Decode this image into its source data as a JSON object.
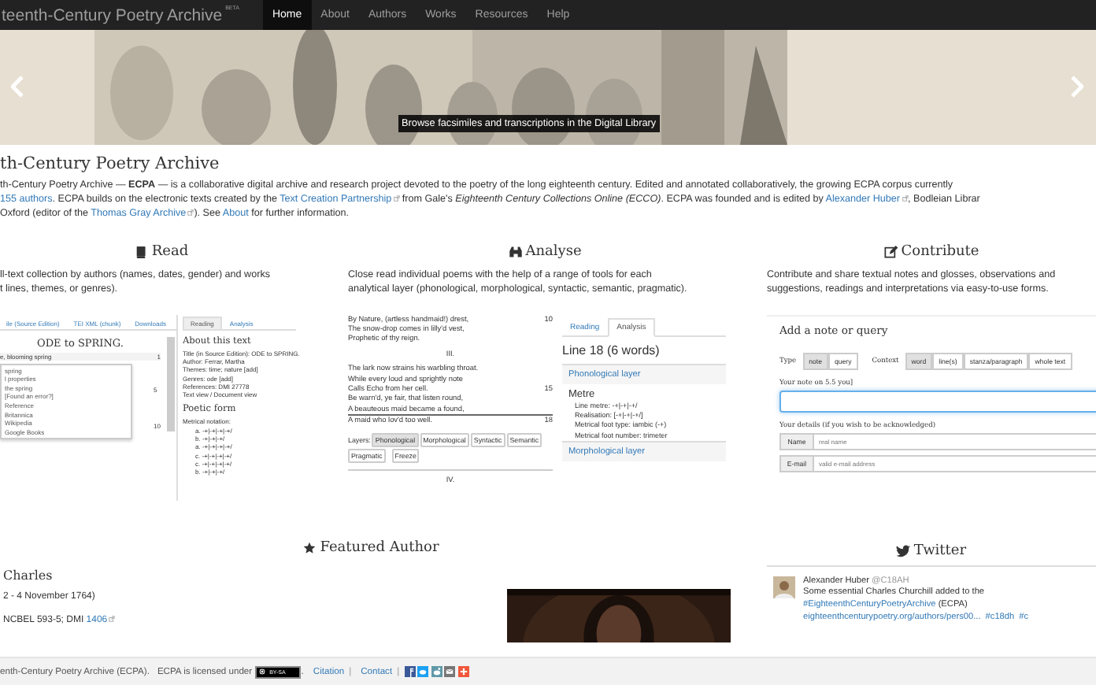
{
  "navbar": {
    "brand": "teenth-Century Poetry Archive",
    "badge": "BETA",
    "items": [
      {
        "label": "Home",
        "selected": true
      },
      {
        "label": "About",
        "selected": false
      },
      {
        "label": "Authors",
        "selected": false
      },
      {
        "label": "Works",
        "selected": false
      },
      {
        "label": "Resources",
        "selected": false
      },
      {
        "label": "Help",
        "selected": false
      }
    ]
  },
  "banner": {
    "kind": "picture",
    "caption": "Browse facsimiles and transcriptions in the Digital Library"
  },
  "intro": {
    "title": "th-Century Poetry Archive",
    "lines": [
      [
        {
          "kind": "text",
          "text": "th-Century Poetry Archive — **ECPA** — is a collaborative digital archive and research project devoted to the poetry of the long eighteenth century. Edited and annotated collaboratively, the growing ECPA corpus currently"
        }
      ],
      [
        {
          "kind": "link",
          "text": "155 authors",
          "external": false
        },
        {
          "kind": "text",
          "text": ". ECPA builds on the electronic texts created by the "
        },
        {
          "kind": "link",
          "text": "Text Creation Partnership",
          "external": true
        },
        {
          "kind": "text",
          "text": " from Gale's *Eighteenth Century Collections Online (ECCO)*. ECPA was founded and is edited by "
        },
        {
          "kind": "link",
          "text": "Alexander Huber",
          "external": true
        },
        {
          "kind": "text",
          "text": ", Bodleian Librar"
        }
      ],
      [
        {
          "kind": "text",
          "text": "Oxford (editor of the "
        },
        {
          "kind": "link",
          "text": "Thomas Gray Archive",
          "external": true
        },
        {
          "kind": "text",
          "text": "). See "
        },
        {
          "kind": "link",
          "text": "About",
          "external": false
        },
        {
          "kind": "text",
          "text": " for further information."
        }
      ]
    ]
  },
  "features": [
    {
      "kind": "read",
      "title": "Read",
      "description": [
        "ll-text collection by authors (names, dates, gender) and works",
        "t lines, themes, or genres)."
      ],
      "preview": {
        "tabs": [
          {
            "label": "ile (Source Edition)",
            "selected": false
          },
          {
            "label": "TEI XML (chunk)",
            "selected": false
          },
          {
            "label": "Downloads",
            "selected": false
          }
        ],
        "poem_title": "ODE to SPRING.",
        "first_line": "e, blooming spring",
        "line_numbers": [
          "1",
          "5",
          "10"
        ],
        "popup": [
          "spring",
          "l properties",
          "the spring",
          "[Found an error?]",
          "Reference",
          "Britannica",
          "Wikipedia",
          "Google Books"
        ],
        "side_tabs": [
          {
            "label": "Reading",
            "selected": true
          },
          {
            "label": "Analysis",
            "selected": false
          }
        ],
        "about_title": "About this text",
        "meta": [
          "Title (in Source Edition): ODE to SPRING.",
          "Author: Ferrar, Martha",
          "Themes: time; nature [add]",
          "Genres: ode [add]",
          "References: DMI 27778",
          "Text view / Document view"
        ],
        "form_title": "Poetic form",
        "notation_label": "Metrical notation:",
        "notation": [
          "a. -+|-+|-+|-+/",
          "b. -+|-+|-+/",
          "a. -+|-+|-+|-+/",
          "c. -+|-+|-+|-+/",
          "c. -+|-+|-+|-+/",
          "b. -+|-+|-+/"
        ]
      }
    },
    {
      "kind": "analyse",
      "title": "Analyse",
      "description": [
        "Close read individual poems with the help of a range of tools for each",
        "analytical layer (phonological, morphological, syntactic, semantic, pragmatic)."
      ],
      "preview": {
        "lines": [
          {
            "kind": "verse",
            "text": "By Nature, (artless handmaid!) drest,",
            "number": "10"
          },
          {
            "kind": "verse",
            "text": "The snow-drop comes in lilly'd vest,"
          },
          {
            "kind": "verse",
            "text": "Prophetic of thy reign."
          },
          {
            "kind": "heading",
            "text": "III."
          },
          {
            "kind": "verse",
            "text": "The lark now strains his warbling throat."
          },
          {
            "kind": "verse",
            "text": "While every loud and sprightly note"
          },
          {
            "kind": "verse",
            "text": "Calls Echo from her cell.",
            "number": "15"
          },
          {
            "kind": "verse",
            "text": "Be warn'd, ye fair, that listen round,"
          },
          {
            "kind": "verse",
            "text": "A beauteous maid became a found,"
          },
          {
            "kind": "current",
            "text": "A maid who lov'd too well.",
            "number": "18"
          }
        ],
        "layers_label": "Layers:",
        "layers": [
          {
            "label": "Phonological",
            "selected": true
          },
          {
            "label": "Morphological",
            "selected": false
          },
          {
            "label": "Syntactic",
            "selected": false
          },
          {
            "label": "Semantic",
            "selected": false
          },
          {
            "label": "Pragmatic",
            "selected": false
          }
        ],
        "freeze": "Freeze",
        "next_heading": "IV.",
        "tabs": [
          {
            "label": "Reading",
            "selected": false
          },
          {
            "label": "Analysis",
            "selected": true
          }
        ],
        "line_title": "Line 18 (6 words)",
        "layer_title": "Phonological layer",
        "metre_title": "Metre",
        "metre": [
          "Line metre: -+|-+|-+/",
          "Realisation: [-+|-+|-+/]",
          "Metrical foot type: iambic (-+)",
          "Metrical foot number: trimeter"
        ],
        "next_layer": "Morphological layer"
      }
    },
    {
      "kind": "contribute",
      "title": "Contribute",
      "description": [
        "Contribute and share textual notes and glosses, observations and",
        "suggestions, readings and interpretations via easy-to-use forms."
      ],
      "preview": {
        "title": "Add a note or query",
        "type_label": "Type",
        "types": [
          {
            "label": "note",
            "selected": true
          },
          {
            "label": "query",
            "selected": false
          }
        ],
        "context_label": "Context",
        "contexts": [
          {
            "label": "word",
            "selected": true
          },
          {
            "label": "line(s)",
            "selected": false
          },
          {
            "label": "stanza/paragraph",
            "selected": false
          },
          {
            "label": "whole text",
            "selected": false
          }
        ],
        "note_label": "Your note on 5.5 you]",
        "details_label": "Your details (if you wish to be acknowledged)",
        "fields": [
          {
            "label": "Name",
            "placeholder": "real name"
          },
          {
            "label": "E-mail",
            "placeholder": "valid e-mail address"
          }
        ]
      }
    }
  ],
  "featured": {
    "title": "Featured Author",
    "name": "Charles",
    "dates": "2 - 4 November 1764)",
    "refs_text": "NCBEL 593-5; DMI ",
    "refs_link": "1406"
  },
  "twitter": {
    "title": "Twitter",
    "author": "Alexander Huber",
    "handle": "@C18AH",
    "lines": [
      [
        {
          "kind": "text",
          "text": "Some essential Charles Churchill added to the"
        }
      ],
      [
        {
          "kind": "link",
          "text": "#EighteenthCenturyPoetryArchive"
        },
        {
          "kind": "text",
          "text": " (ECPA)"
        }
      ],
      [
        {
          "kind": "link",
          "text": "eighteenthcenturypoetry.org/authors/pers00..."
        },
        {
          "kind": "link",
          "text": "#c18dh"
        },
        {
          "kind": "link",
          "text": "#c"
        }
      ]
    ]
  },
  "footer": {
    "text": "enth-Century Poetry Archive (ECPA).",
    "license": "ECPA is licensed under",
    "badge": "BY-SA",
    "after_badge": ".",
    "links": [
      "Citation",
      "Contact"
    ],
    "separator": "|"
  }
}
